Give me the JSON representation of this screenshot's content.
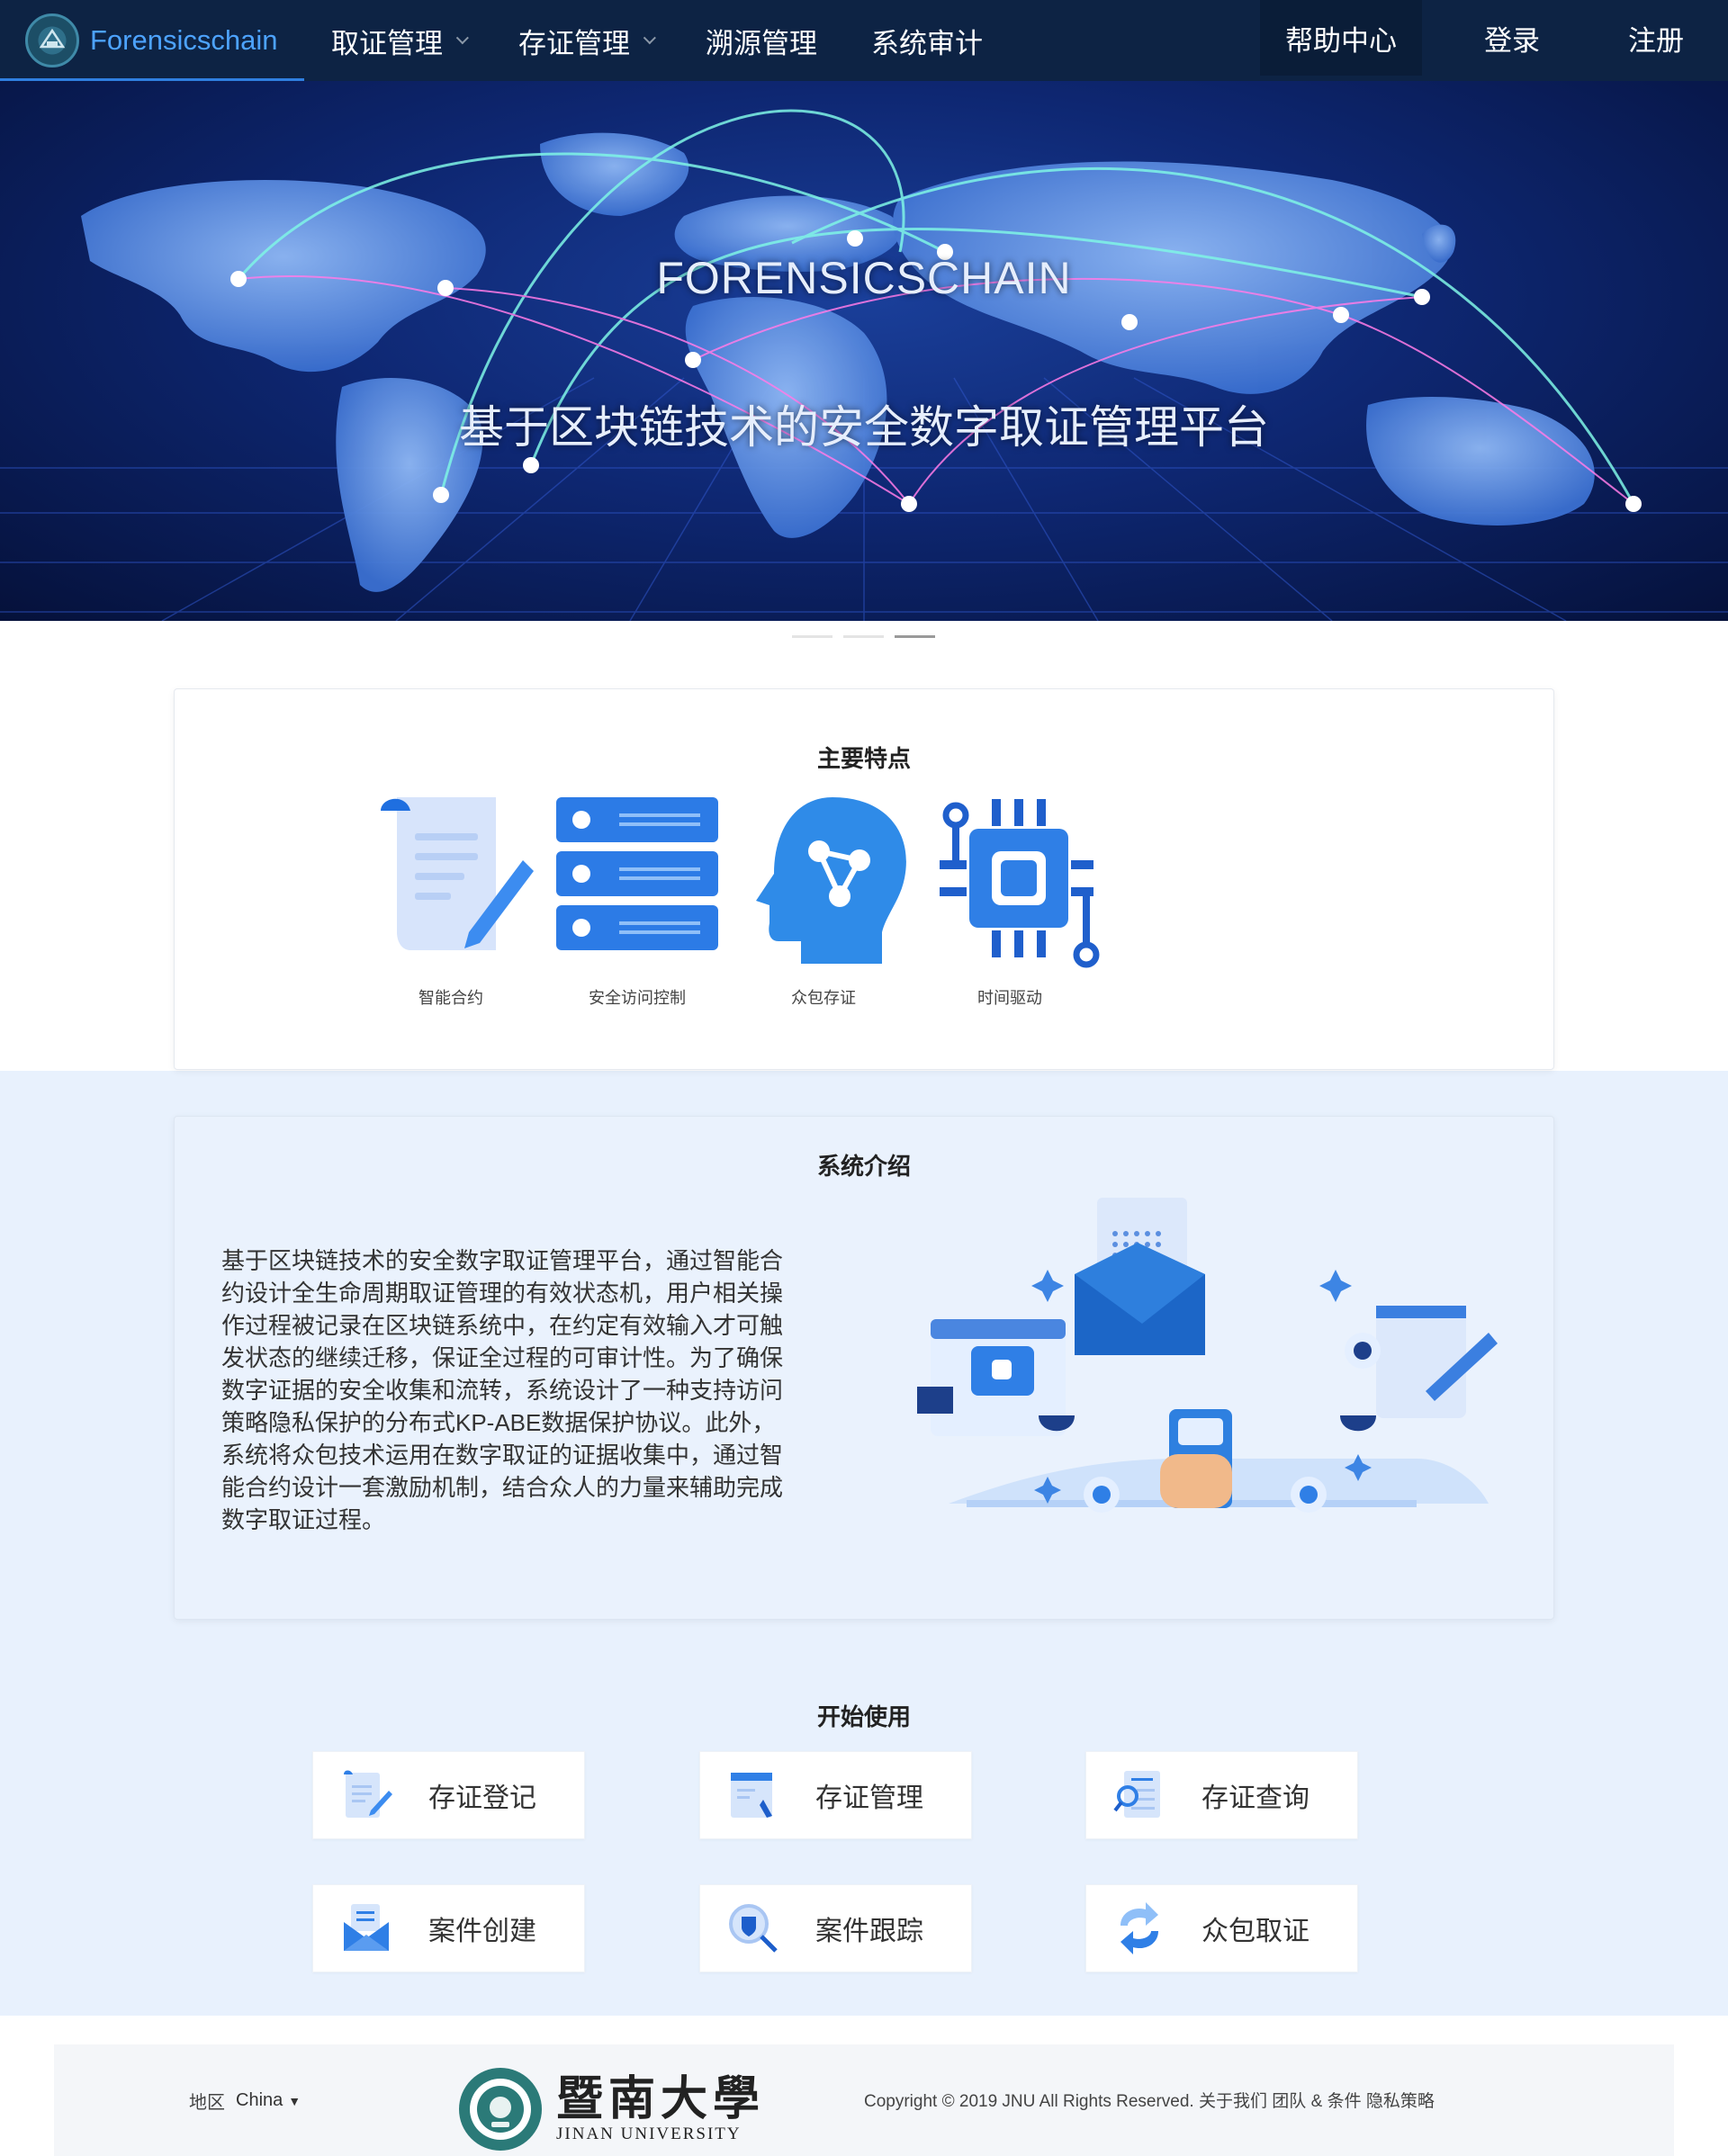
{
  "nav": {
    "brand": "Forensicschain",
    "items": [
      {
        "label": "取证管理",
        "dropdown": true
      },
      {
        "label": "存证管理",
        "dropdown": true
      },
      {
        "label": "溯源管理",
        "dropdown": false
      },
      {
        "label": "系统审计",
        "dropdown": false
      }
    ],
    "help": "帮助中心",
    "login": "登录",
    "register": "注册"
  },
  "hero": {
    "title": "FORENSICSCHAIN",
    "subtitle": "基于区块链技术的安全数字取证管理平台",
    "slides": 3,
    "active_slide": 3
  },
  "features": {
    "title": "主要特点",
    "items": [
      {
        "label": "智能合约",
        "icon": "contract-icon"
      },
      {
        "label": "安全访问控制",
        "icon": "server-icon"
      },
      {
        "label": "众包存证",
        "icon": "brain-icon"
      },
      {
        "label": "时间驱动",
        "icon": "chip-icon"
      }
    ]
  },
  "intro": {
    "title": "系统介绍",
    "text": "基于区块链技术的安全数字取证管理平台，通过智能合约设计全生命周期取证管理的有效状态机，用户相关操作过程被记录在区块链系统中，在约定有效输入才可触发状态的继续迁移，保证全过程的可审计性。为了确保数字证据的安全收集和流转，系统设计了一种支持访问策略隐私保护的分布式KP-ABE数据保护协议。此外，系统将众包技术运用在数字取证的证据收集中，通过智能合约设计一套激励机制，结合众人的力量来辅助完成数字取证过程。"
  },
  "start": {
    "title": "开始使用",
    "tiles": [
      {
        "label": "存证登记",
        "icon": "register-doc-icon"
      },
      {
        "label": "存证管理",
        "icon": "manage-doc-icon"
      },
      {
        "label": "存证查询",
        "icon": "search-doc-icon"
      },
      {
        "label": "案件创建",
        "icon": "create-case-icon"
      },
      {
        "label": "案件跟踪",
        "icon": "track-case-icon"
      },
      {
        "label": "众包取证",
        "icon": "crowd-icon"
      }
    ]
  },
  "footer": {
    "region_label": "地区",
    "region_value": "China",
    "univ_cn": "暨南大學",
    "univ_en": "JINAN UNIVERSITY",
    "copyright": "Copyright © 2019 JNU All Rights Reserved.",
    "links": [
      "关于我们",
      "团队",
      "&",
      "条件",
      "隐私策略"
    ]
  },
  "colors": {
    "nav_bg": "#0d2344",
    "brand_accent": "#4da3ff",
    "band_bg": "#e8f1fd",
    "icon_blue": "#2b7de9"
  }
}
